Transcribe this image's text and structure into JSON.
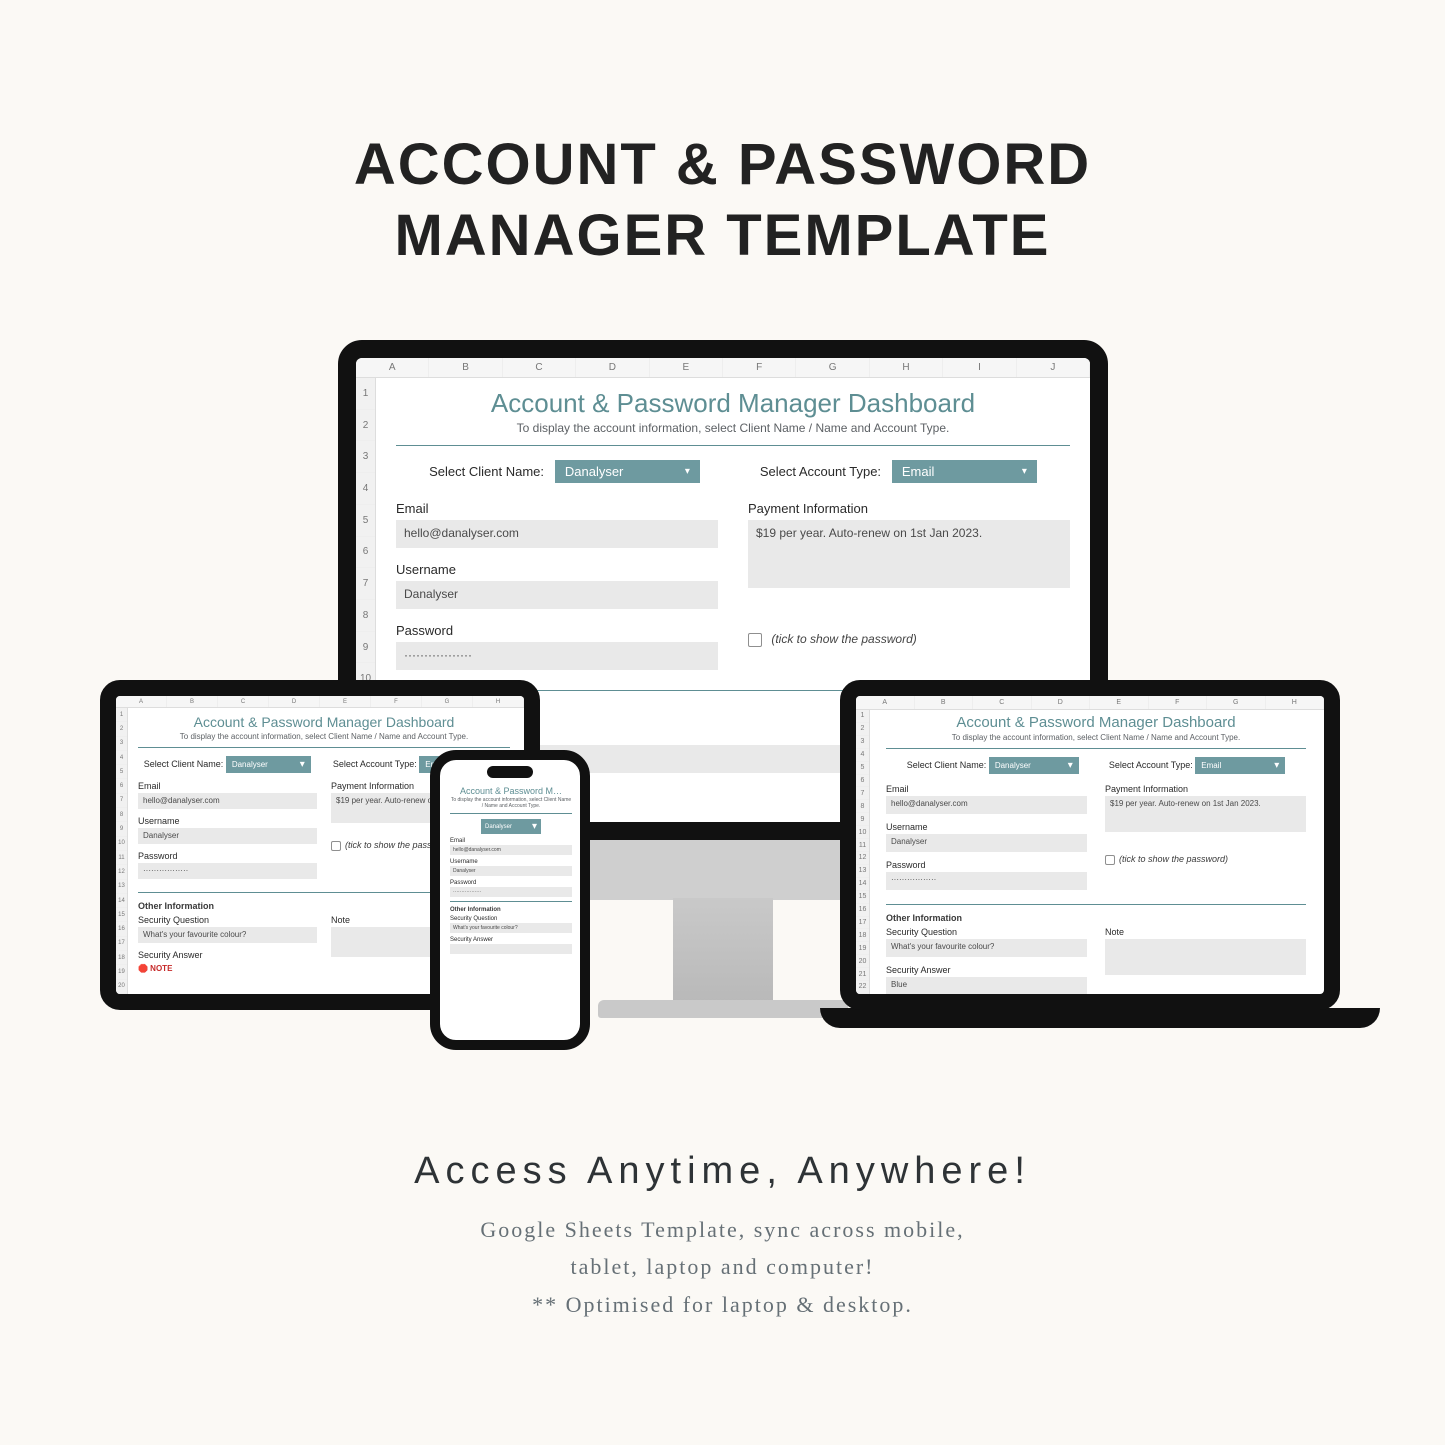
{
  "hero": {
    "line1": "ACCOUNT & PASSWORD",
    "line2": "MANAGER TEMPLATE"
  },
  "footer": {
    "tagline": "Access Anytime, Anywhere!",
    "line1": "Google Sheets Template, sync across mobile,",
    "line2": "tablet, laptop and computer!",
    "line3": "** Optimised for laptop & desktop."
  },
  "sheet": {
    "title": "Account & Password Manager Dashboard",
    "subtitle": "To display the account information, select Client Name / Name and Account Type.",
    "select_client_label": "Select Client Name:",
    "select_client_value": "Danalyser",
    "select_type_label": "Select Account Type:",
    "select_type_value": "Email",
    "email_label": "Email",
    "email_value": "hello@danalyser.com",
    "username_label": "Username",
    "username_value": "Danalyser",
    "password_label": "Password",
    "password_value": "·················",
    "password_tick_label": "(tick to show the password)",
    "payment_label": "Payment Information",
    "payment_value": "$19 per year. Auto-renew on 1st Jan 2023.",
    "other_heading": "Other Information",
    "secq_label": "Security Question",
    "secq_value": "What's your favourite colour?",
    "seca_label": "Security Answer",
    "seca_value": "Blue",
    "note_label": "Note",
    "note_prefix": "🛑 NOTE"
  },
  "grid": {
    "cols": [
      "A",
      "B",
      "C",
      "D",
      "E",
      "F",
      "G",
      "H",
      "I",
      "J"
    ],
    "rows": [
      "1",
      "2",
      "3",
      "4",
      "5",
      "6",
      "7",
      "8",
      "9",
      "10",
      "11",
      "12",
      "13",
      "14",
      "15",
      "16",
      "17",
      "18",
      "19",
      "20",
      "21",
      "22"
    ]
  }
}
